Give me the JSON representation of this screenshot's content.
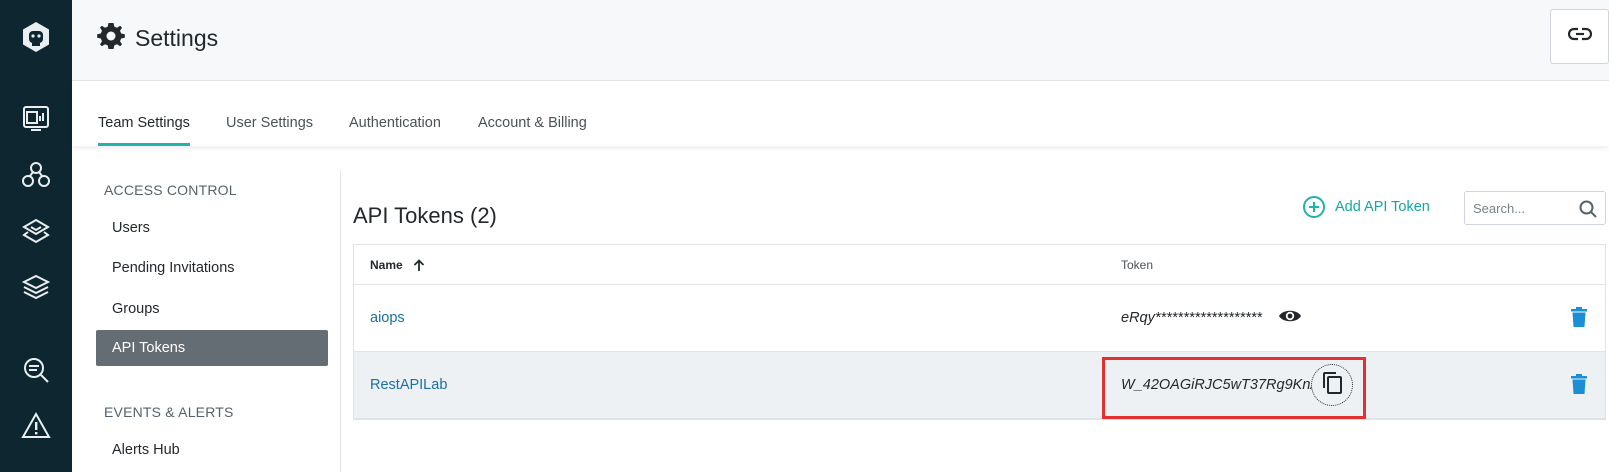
{
  "header": {
    "title": "Settings"
  },
  "tabs": [
    {
      "label": "Team Settings",
      "active": true
    },
    {
      "label": "User Settings",
      "active": false
    },
    {
      "label": "Authentication",
      "active": false
    },
    {
      "label": "Account & Billing",
      "active": false
    }
  ],
  "sidenav": {
    "sections": [
      {
        "label": "ACCESS CONTROL"
      },
      {
        "label": "EVENTS & ALERTS"
      }
    ],
    "items": [
      {
        "label": "Users",
        "active": false
      },
      {
        "label": "Pending Invitations",
        "active": false
      },
      {
        "label": "Groups",
        "active": false
      },
      {
        "label": "API Tokens",
        "active": true
      },
      {
        "label": "Alerts Hub",
        "active": false
      }
    ]
  },
  "main": {
    "heading": "API Tokens (2)",
    "add_label": "Add API Token",
    "search_placeholder": "Search...",
    "columns": {
      "name": "Name",
      "token": "Token"
    },
    "rows": [
      {
        "name": "aiops",
        "token": "eRqy*******************"
      },
      {
        "name": "RestAPILab",
        "token": "W_42OAGiRJC5wT37Rg9KnA"
      }
    ]
  },
  "colors": {
    "rail": "#0e2630",
    "accent": "#1fb3ac",
    "link": "#1a6fa3",
    "highlight": "#e53030",
    "delete": "#1a8fd6"
  },
  "icons": [
    "logo-icon",
    "dashboard-icon",
    "services-icon",
    "integrations-icon",
    "layers-icon",
    "search-analytics-icon",
    "alert-icon",
    "gear-icon",
    "link-icon",
    "plus-icon",
    "search-icon",
    "sort-up-icon",
    "eye-icon",
    "trash-icon",
    "copy-icon"
  ]
}
